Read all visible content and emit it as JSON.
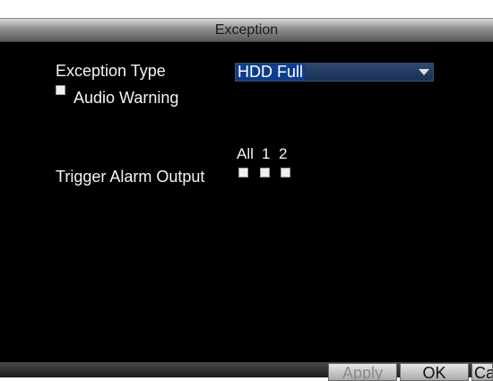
{
  "dialog": {
    "title": "Exception"
  },
  "exception_type": {
    "label": "Exception Type",
    "selected": "HDD Full"
  },
  "audio_warning": {
    "label": "Audio Warning",
    "checked": false
  },
  "trigger_alarm_output": {
    "label": "Trigger Alarm Output",
    "columns": [
      "All",
      "1",
      "2"
    ]
  },
  "buttons": {
    "apply": "Apply",
    "ok": "OK",
    "cancel": "Cancel"
  }
}
